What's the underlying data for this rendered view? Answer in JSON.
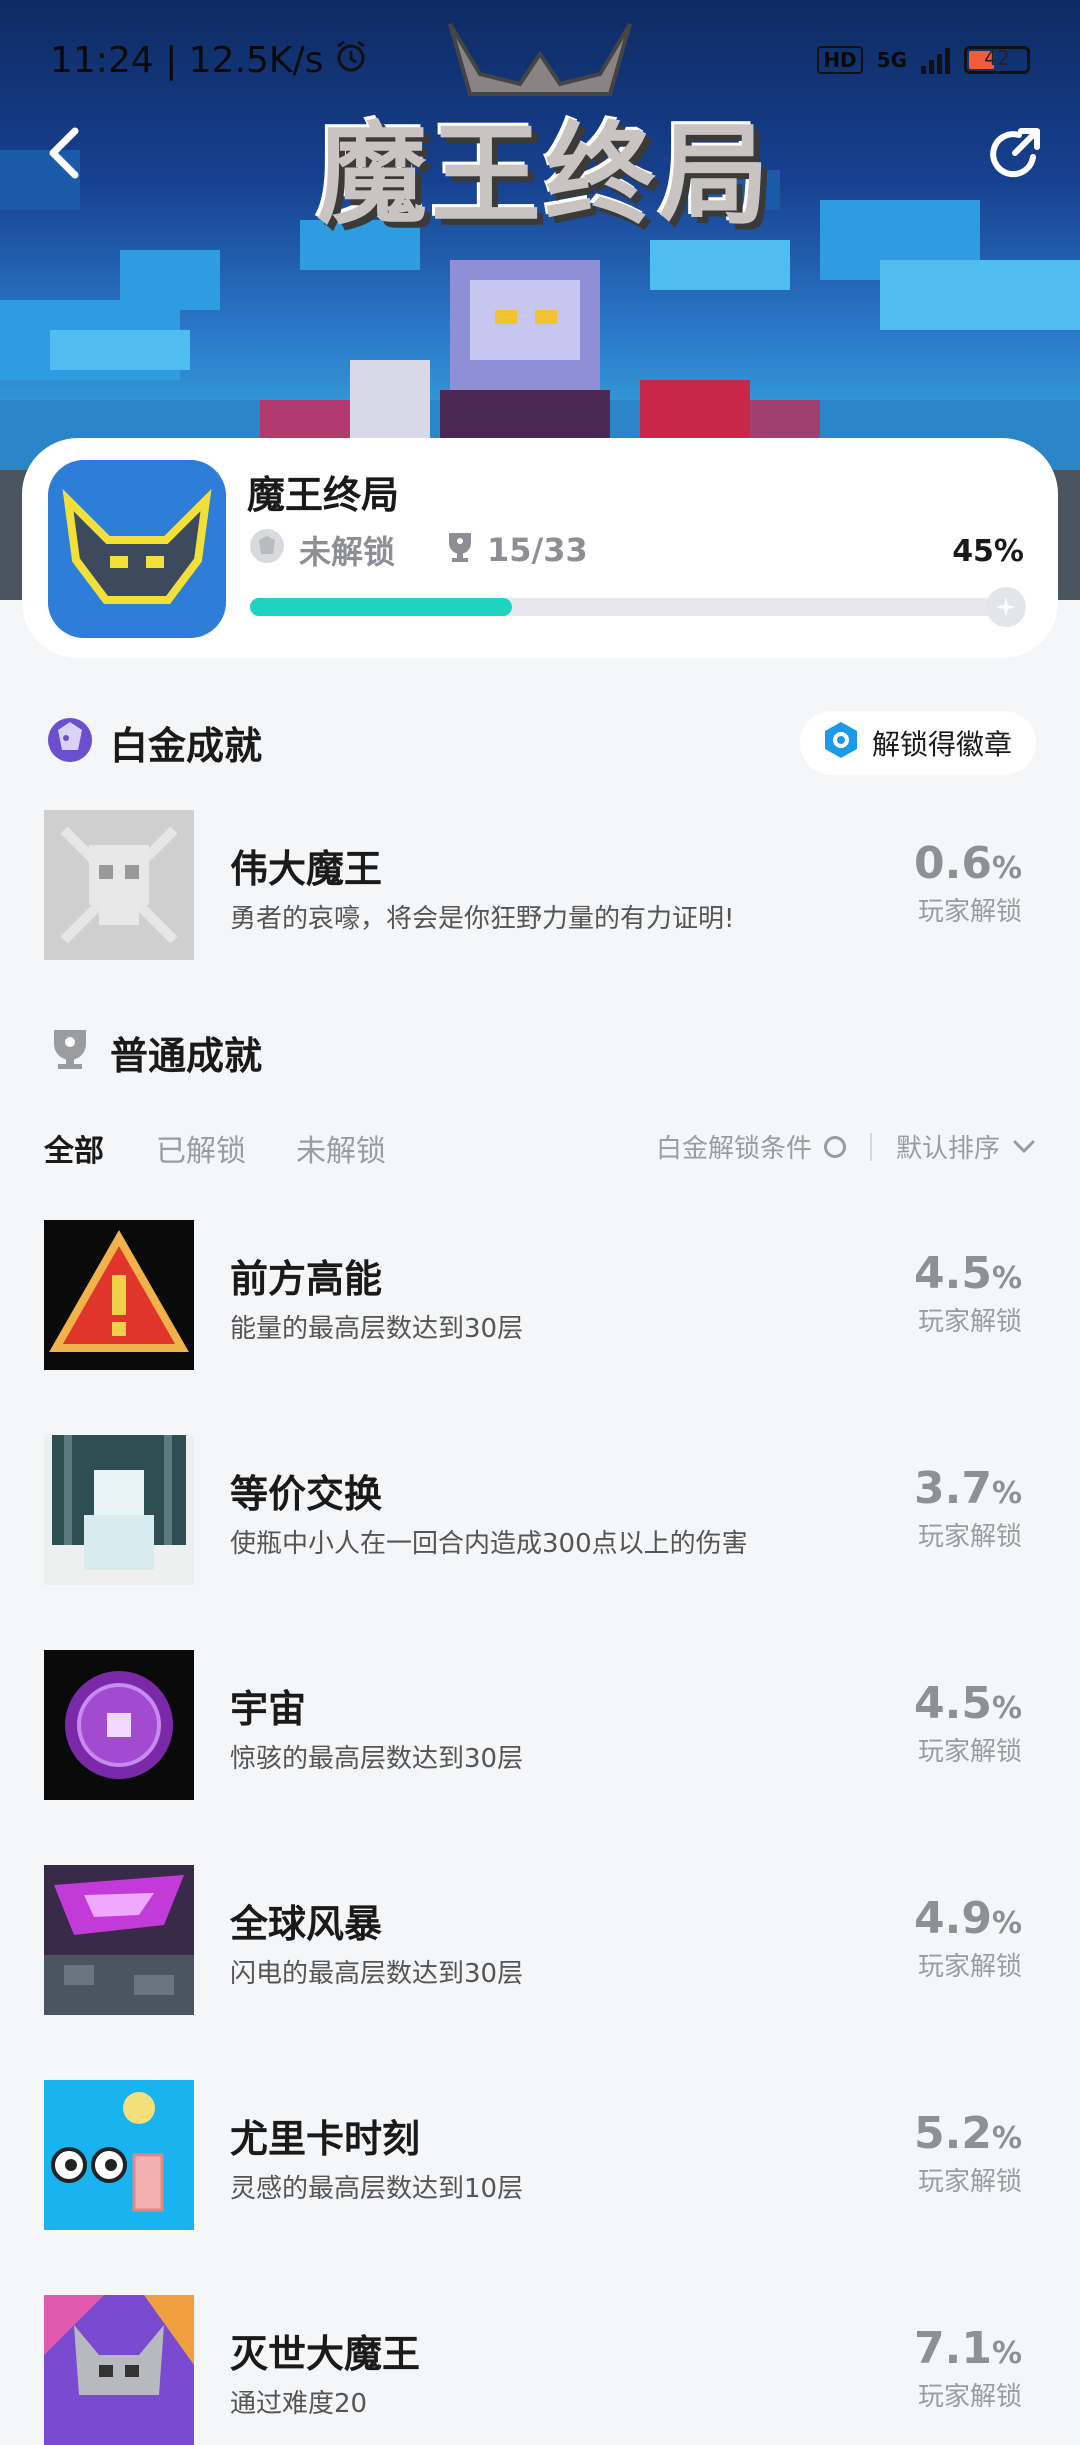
{
  "status_bar": {
    "time_speed": "11:24 | 12.5K/s",
    "hd": "HD",
    "network": "5G",
    "battery": "42"
  },
  "header": {
    "logo_text": "魔王终局"
  },
  "game": {
    "title": "魔王终局",
    "lock_status": "未解锁",
    "count": "15/33",
    "progress_text": "45%",
    "progress_value": 0.34
  },
  "platinum": {
    "heading": "白金成就",
    "badge_button": "解锁得徽章",
    "item": {
      "title": "伟大魔王",
      "desc": "勇者的哀嚎，将会是你狂野力量的有力证明!",
      "rate": "0.6",
      "rate_unit": "%",
      "rate_label": "玩家解锁"
    }
  },
  "normal": {
    "heading": "普通成就",
    "tabs": [
      "全部",
      "已解锁",
      "未解锁"
    ],
    "platinum_condition": "白金解锁条件",
    "sort": "默认排序",
    "items": [
      {
        "title": "前方高能",
        "desc": "能量的最高层数达到30层",
        "rate": "4.5",
        "rate_unit": "%",
        "rate_label": "玩家解锁"
      },
      {
        "title": "等价交换",
        "desc": "使瓶中小人在一回合内造成300点以上的伤害",
        "rate": "3.7",
        "rate_unit": "%",
        "rate_label": "玩家解锁"
      },
      {
        "title": "宇宙",
        "desc": "惊骇的最高层数达到30层",
        "rate": "4.5",
        "rate_unit": "%",
        "rate_label": "玩家解锁"
      },
      {
        "title": "全球风暴",
        "desc": "闪电的最高层数达到30层",
        "rate": "4.9",
        "rate_unit": "%",
        "rate_label": "玩家解锁"
      },
      {
        "title": "尤里卡时刻",
        "desc": "灵感的最高层数达到10层",
        "rate": "5.2",
        "rate_unit": "%",
        "rate_label": "玩家解锁"
      },
      {
        "title": "灭世大魔王",
        "desc": "通过难度20",
        "rate": "7.1",
        "rate_unit": "%",
        "rate_label": "玩家解锁"
      }
    ]
  },
  "colors": {
    "accent": "#1fd3c3",
    "background": "#f5f6f8",
    "muted": "#8e9095"
  }
}
